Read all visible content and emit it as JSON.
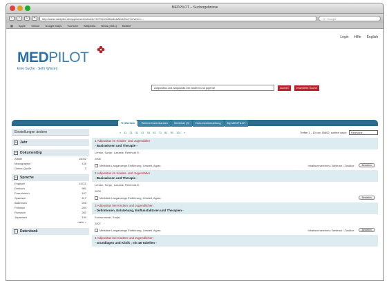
{
  "window": {
    "title": "MEDPILOT – Suchergebnisse",
    "url": "http://www.medpilot.de/app/search/search/?HITSinOrdMode&ADAS0o7/m/Verm=...",
    "search_placeholder": "Q~ Google",
    "bookmarks": [
      "Apple",
      "Yahoo!",
      "Google Maps",
      "YouTube",
      "Wikipedia",
      "News (1031)",
      "Beliebt"
    ]
  },
  "colors": {
    "brand_blue": "#2a6fa7",
    "brand_red": "#b8222b",
    "tab_bar": "#2a6c8c",
    "result_bg": "#dcecf0"
  },
  "header": {
    "top_links": [
      "Login",
      "Hilfe",
      "English"
    ],
    "logo_med": "MED",
    "logo_pilot": "PILOT",
    "tagline": "Eine Suche · Sehr Wissen",
    "search_value": "Adipositas und adipositas bei kindern und jugendl",
    "search_btn": "suchen",
    "advanced_btn": "erweiterte Suche"
  },
  "tabs": [
    "Trefferliste",
    "Weitere Datenbanken",
    "Merkliste (0)",
    "Dokumentbestellung",
    "My MEDPILOT"
  ],
  "sidebar": {
    "settings": "Einstellungen ändern",
    "sections": [
      {
        "label": "Jahr",
        "expanded": false,
        "items": []
      },
      {
        "label": "Dokumenttyp",
        "expanded": true,
        "items": [
          {
            "name": "Artikel",
            "count": "15032"
          },
          {
            "name": "Monographie",
            "count": "139"
          },
          {
            "name": "Online-Quelle",
            "count": "3"
          }
        ]
      },
      {
        "label": "Sprache",
        "expanded": true,
        "more": "mehr >",
        "items": [
          {
            "name": "Englisch",
            "count": "14721"
          },
          {
            "name": "Deutsch",
            "count": "981"
          },
          {
            "name": "Französisch",
            "count": "107"
          },
          {
            "name": "Spanisch",
            "count": "417"
          },
          {
            "name": "Italienisch",
            "count": "205"
          },
          {
            "name": "Polnisch",
            "count": "204"
          },
          {
            "name": "Russisch",
            "count": "282"
          },
          {
            "name": "Japanisch",
            "count": "190"
          }
        ]
      },
      {
        "label": "Datenbank",
        "expanded": false,
        "items": []
      }
    ]
  },
  "results": {
    "pages": [
      "«",
      "11",
      "21",
      "31",
      "41",
      "51",
      "61",
      "71",
      "81",
      "91",
      "101",
      "»"
    ],
    "summary": "Treffer 1 - 10 von 15602, sortiert nach:",
    "sort": "Relevanz",
    "items": [
      {
        "title": "1  Adipositas im Kindes- und Jugendalter",
        "subtitle": "- Basiswissen und Therapie -",
        "authors": "Lehrke, Sonja ; Laessle, Reinhold G.",
        "year": "2006",
        "tags": "Merkliste   Langanzeige   Einführung, Umwelt, Agras",
        "links": "Inhaltsverzeichnis / Abstract / Zusätze",
        "button": "Bestellen"
      },
      {
        "title": "2  Adipositas im Kindes- und Jugendalter",
        "subtitle": "- Basiswissen und Therapie -",
        "authors": "Lehrke, Sonja ; Laessle, Reinhold G.",
        "year": "2009",
        "tags": "Merkliste   Langanzeige   Einführung, Umwelt, Agras",
        "links": "",
        "button": "Bestellen"
      },
      {
        "title": "3  Adipositas bei Kindern und Jugendlichen",
        "subtitle": "- Definitionen, Entstehung, Einflussfaktoren und Therapien -",
        "authors": "Kochanowski, Sonja",
        "year": "2007",
        "tags": "Merkliste   Langanzeige   Einführung, Umwelt, Agras",
        "links": "Inhaltsverzeichnis / Abstract / Zusätze",
        "button": "Bestellen"
      },
      {
        "title": "4  Adipositas bei Kindern und Jugendlichen",
        "subtitle": "- Grundlagen und Klinik ; mit 48 Tabellen -",
        "authors": "",
        "year": "",
        "tags": "",
        "links": "",
        "button": ""
      }
    ]
  }
}
